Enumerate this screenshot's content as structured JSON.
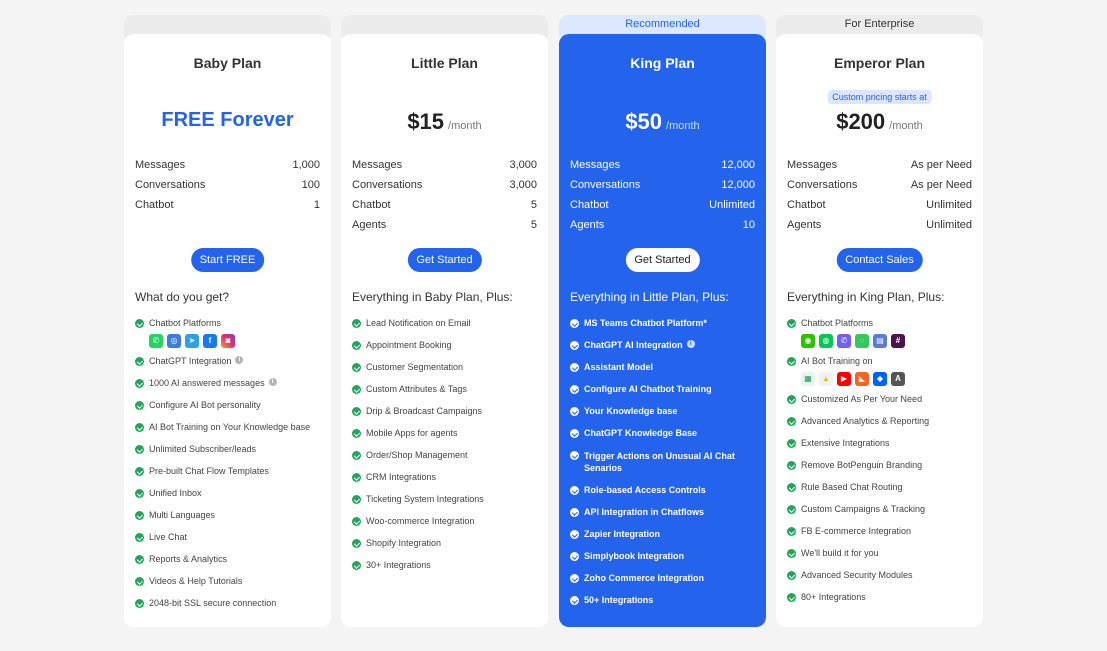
{
  "plans": [
    {
      "tag": "",
      "name": "Baby Plan",
      "price": "FREE Forever",
      "per": "",
      "stats": [
        {
          "label": "Messages",
          "value": "1,000"
        },
        {
          "label": "Conversations",
          "value": "100"
        },
        {
          "label": "Chatbot",
          "value": "1"
        }
      ],
      "cta": "Start FREE",
      "subtitle": "What do you get?",
      "platforms_label": "Chatbot Platforms",
      "platform_icons": [
        "whatsapp-icon",
        "web-icon",
        "telegram-icon",
        "facebook-icon",
        "instagram-icon"
      ],
      "features": [
        "ChatGPT Integration",
        "1000 AI answered messages",
        "Configure AI Bot personality",
        "AI Bot Training on Your Knowledge base",
        "Unlimited Subscriber/leads",
        "Pre-built Chat Flow Templates",
        "Unified Inbox",
        "Multi Languages",
        "Live Chat",
        "Reports & Analytics",
        "Videos & Help Tutorials",
        "2048-bit SSL secure connection"
      ]
    },
    {
      "tag": "",
      "name": "Little Plan",
      "price": "$15",
      "per": "/month",
      "stats": [
        {
          "label": "Messages",
          "value": "3,000"
        },
        {
          "label": "Conversations",
          "value": "3,000"
        },
        {
          "label": "Chatbot",
          "value": "5"
        },
        {
          "label": "Agents",
          "value": "5"
        }
      ],
      "cta": "Get Started",
      "subtitle": "Everything in Baby Plan, Plus:",
      "features": [
        "Lead Notification on Email",
        "Appointment Booking",
        "Customer Segmentation",
        "Custom Attributes & Tags",
        "Drip & Broadcast Campaigns",
        "Mobile Apps for agents",
        "Order/Shop Management",
        "CRM Integrations",
        "Ticketing System Integrations",
        "Woo-commerce Integration",
        "Shopify Integration",
        "30+ Integrations"
      ]
    },
    {
      "tag": "Recommended",
      "name": "King Plan",
      "price": "$50",
      "per": "/month",
      "stats": [
        {
          "label": "Messages",
          "value": "12,000"
        },
        {
          "label": "Conversations",
          "value": "12,000"
        },
        {
          "label": "Chatbot",
          "value": "Unlimited"
        },
        {
          "label": "Agents",
          "value": "10"
        }
      ],
      "cta": "Get Started",
      "subtitle": "Everything in Little Plan, Plus:",
      "features": [
        "MS Teams Chatbot Platform*",
        "ChatGPT AI Integration",
        "Assistant Model",
        "Configure AI Chatbot Training",
        "Your Knowledge base",
        "ChatGPT Knowledge Base",
        "Trigger Actions on Unusual AI Chat Senarios",
        "Role-based Access Controls",
        "API Integration in Chatflows",
        "Zapier Integration",
        "Simplybook Integration",
        "Zoho Commerce Integration",
        "50+ Integrations"
      ]
    },
    {
      "tag": "For Enterprise",
      "name": "Emperor Plan",
      "badge": "Custom pricing starts at",
      "price": "$200",
      "per": "/month",
      "stats": [
        {
          "label": "Messages",
          "value": "As per Need"
        },
        {
          "label": "Conversations",
          "value": "As per Need"
        },
        {
          "label": "Chatbot",
          "value": "Unlimited"
        },
        {
          "label": "Agents",
          "value": "Unlimited"
        }
      ],
      "cta": "Contact Sales",
      "subtitle": "Everything in King Plan, Plus:",
      "platforms_label": "Chatbot Platforms",
      "platform_icons": [
        "wechat-icon",
        "line-icon",
        "viber-icon",
        "imessage-icon",
        "teams-icon",
        "slack-icon"
      ],
      "training_label": "AI Bot Training on",
      "training_icons": [
        "google-sheets-icon",
        "google-drive-icon",
        "youtube-icon",
        "rss-icon",
        "dropbox-icon",
        "text-icon"
      ],
      "features": [
        "Customized As Per Your Need",
        "Advanced Analytics & Reporting",
        "Extensive Integrations",
        "Remove BotPenguin Branding",
        "Rule Based Chat Routing",
        "Custom Campaigns & Tracking",
        "FB E-commerce Integration",
        "We'll build it for you",
        "Advanced Security Modules",
        "80+ Integrations"
      ]
    }
  ],
  "colors": {
    "accent": "#2463eb",
    "check": "#22a55a",
    "page_bg": "#f4f4f5"
  }
}
